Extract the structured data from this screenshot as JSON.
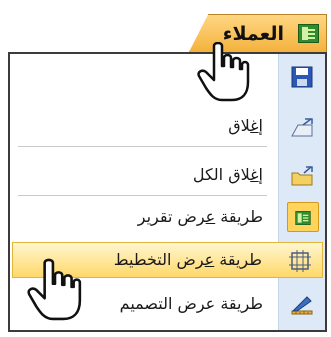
{
  "tab": {
    "label": "العملاء",
    "icon": "table-icon"
  },
  "menu": {
    "items": [
      {
        "label_parts": [
          "",
          "",
          ""
        ],
        "icon": "save-icon"
      },
      {
        "label_pre": "إ",
        "label_ul": "غ",
        "label_post": "لاق",
        "icon": "close-object-icon"
      },
      {
        "label_pre": "إ",
        "label_ul": "غ",
        "label_post": "لاق الكل",
        "icon": "close-all-icon"
      },
      {
        "label_pre": "طريقة ",
        "label_ul": "ع",
        "label_post": "رض تقرير",
        "icon": "report-view-icon"
      },
      {
        "label_pre": "طريقة ",
        "label_ul": "ع",
        "label_post": "رض التخطيط",
        "icon": "layout-view-icon"
      },
      {
        "label_pre": "طريقة عرض التصميم",
        "label_ul": "",
        "label_post": "",
        "icon": "design-view-icon"
      }
    ]
  },
  "cursors": [
    "hand-pointer-icon",
    "hand-pointer-icon"
  ],
  "colors": {
    "tab_top": "#ffd782",
    "tab_bottom": "#f4b13e",
    "gutter": "#dde9f7",
    "highlight": "#ffd86a"
  }
}
